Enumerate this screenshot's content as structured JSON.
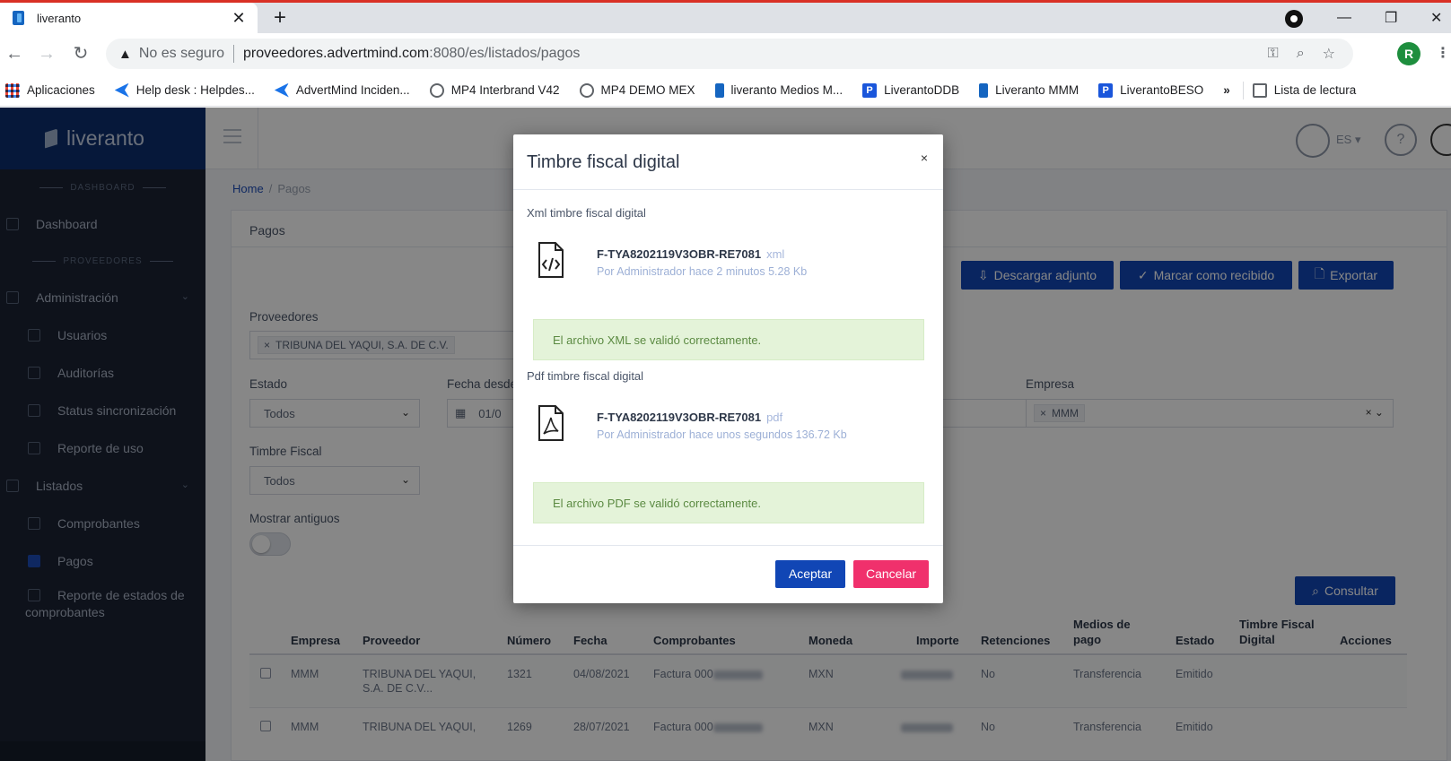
{
  "browser": {
    "tab_title": "liveranto",
    "tab_close": "✕",
    "new_tab": "+",
    "url_warning": "No es seguro",
    "url_host": "proveedores.advertmind.com",
    "url_path": ":8080/es/listados/pagos",
    "profile_initial": "R",
    "bookmarks": [
      "Aplicaciones",
      "Help desk : Helpdes...",
      "AdvertMind Inciden...",
      "MP4 Interbrand V42",
      "MP4 DEMO MEX",
      "liveranto Medios M...",
      "LiverantoDDB",
      "Liveranto MMM",
      "LiverantoBESO"
    ],
    "bookmarks_more": "»",
    "reading_list": "Lista de lectura"
  },
  "sidebar": {
    "logo": "liveranto",
    "section_dashboard": "DASHBOARD",
    "section_proveedores": "PROVEEDORES",
    "dashboard": "Dashboard",
    "administracion": "Administración",
    "usuarios": "Usuarios",
    "auditorias": "Auditorías",
    "status_sync": "Status sincronización",
    "reporte_uso": "Reporte de uso",
    "listados": "Listados",
    "comprobantes": "Comprobantes",
    "pagos": "Pagos",
    "reporte_estados": "Reporte de estados de comprobantes"
  },
  "topbar": {
    "lang": "ES ▾"
  },
  "breadcrumb": {
    "home": "Home",
    "current": "Pagos"
  },
  "page": {
    "card_title": "Pagos",
    "btn_descargar": "Descargar adjunto",
    "btn_marcar": "Marcar como recibido",
    "btn_exportar": "Exportar",
    "btn_consultar": "Consultar",
    "lbl_proveedores": "Proveedores",
    "proveedor_tag": "TRIBUNA DEL YAQUI, S.A. DE C.V.",
    "lbl_estado": "Estado",
    "estado_value": "Todos",
    "lbl_fecha": "Fecha desde",
    "fecha_value": "01/0",
    "lbl_empresa": "Empresa",
    "empresa_tag": "MMM",
    "lbl_timbre": "Timbre Fiscal",
    "timbre_value": "Todos",
    "lbl_mostrar": "Mostrar antiguos"
  },
  "table": {
    "headers": {
      "empresa": "Empresa",
      "proveedor": "Proveedor",
      "numero": "Número",
      "fecha": "Fecha",
      "comprobantes": "Comprobantes",
      "moneda": "Moneda",
      "importe": "Importe",
      "retenciones": "Retenciones",
      "medios_1": "Medios de",
      "medios_2": "pago",
      "estado": "Estado",
      "timbre_1": "Timbre Fiscal",
      "timbre_2": "Digital",
      "acciones": "Acciones"
    },
    "rows": [
      {
        "empresa": "MMM",
        "proveedor_1": "TRIBUNA DEL YAQUI,",
        "proveedor_2": "S.A. DE C.V...",
        "numero": "1321",
        "fecha": "04/08/2021",
        "comprobante": "Factura 000",
        "moneda": "MXN",
        "retenciones": "No",
        "medio": "Transferencia",
        "estado": "Emitido"
      },
      {
        "empresa": "MMM",
        "proveedor_1": "TRIBUNA DEL YAQUI,",
        "proveedor_2": "",
        "numero": "1269",
        "fecha": "28/07/2021",
        "comprobante": "Factura 000",
        "moneda": "MXN",
        "retenciones": "No",
        "medio": "Transferencia",
        "estado": "Emitido"
      }
    ]
  },
  "modal": {
    "title": "Timbre fiscal digital",
    "close": "×",
    "xml_section": "Xml timbre fiscal digital",
    "xml_file": "F-TYA8202119V3OBR-RE7081",
    "xml_ext": "xml",
    "xml_meta": "Por Administrador hace 2 minutos  5.28 Kb",
    "xml_ok": "El archivo XML se validó correctamente.",
    "pdf_section": "Pdf timbre fiscal digital",
    "pdf_file": "F-TYA8202119V3OBR-RE7081",
    "pdf_ext": "pdf",
    "pdf_meta": "Por Administrador hace unos segundos  136.72 Kb",
    "pdf_ok": "El archivo PDF se validó correctamente.",
    "accept": "Aceptar",
    "cancel": "Cancelar"
  },
  "colors": {
    "primary": "#1146b5",
    "danger": "#f0306c",
    "sidebar": "#1b2333",
    "success_bg": "#e4f3d9"
  }
}
